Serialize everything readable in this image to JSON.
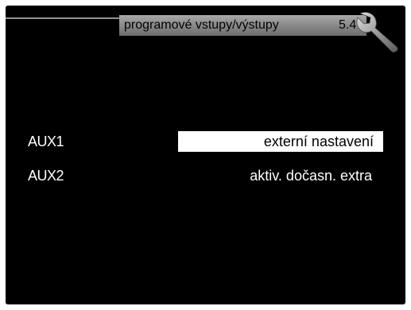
{
  "header": {
    "title": "programové vstupy/výstupy",
    "menu_number": "5.4",
    "icon": "wrench-icon"
  },
  "rows": [
    {
      "label": "AUX1",
      "value": "externí nastavení",
      "selected": true
    },
    {
      "label": "AUX2",
      "value": "aktiv. dočasn. extra",
      "selected": false
    }
  ],
  "colors": {
    "background": "#000000",
    "text": "#ffffff",
    "header_bar": "#8c8c8c",
    "selection": "#ffffff"
  }
}
